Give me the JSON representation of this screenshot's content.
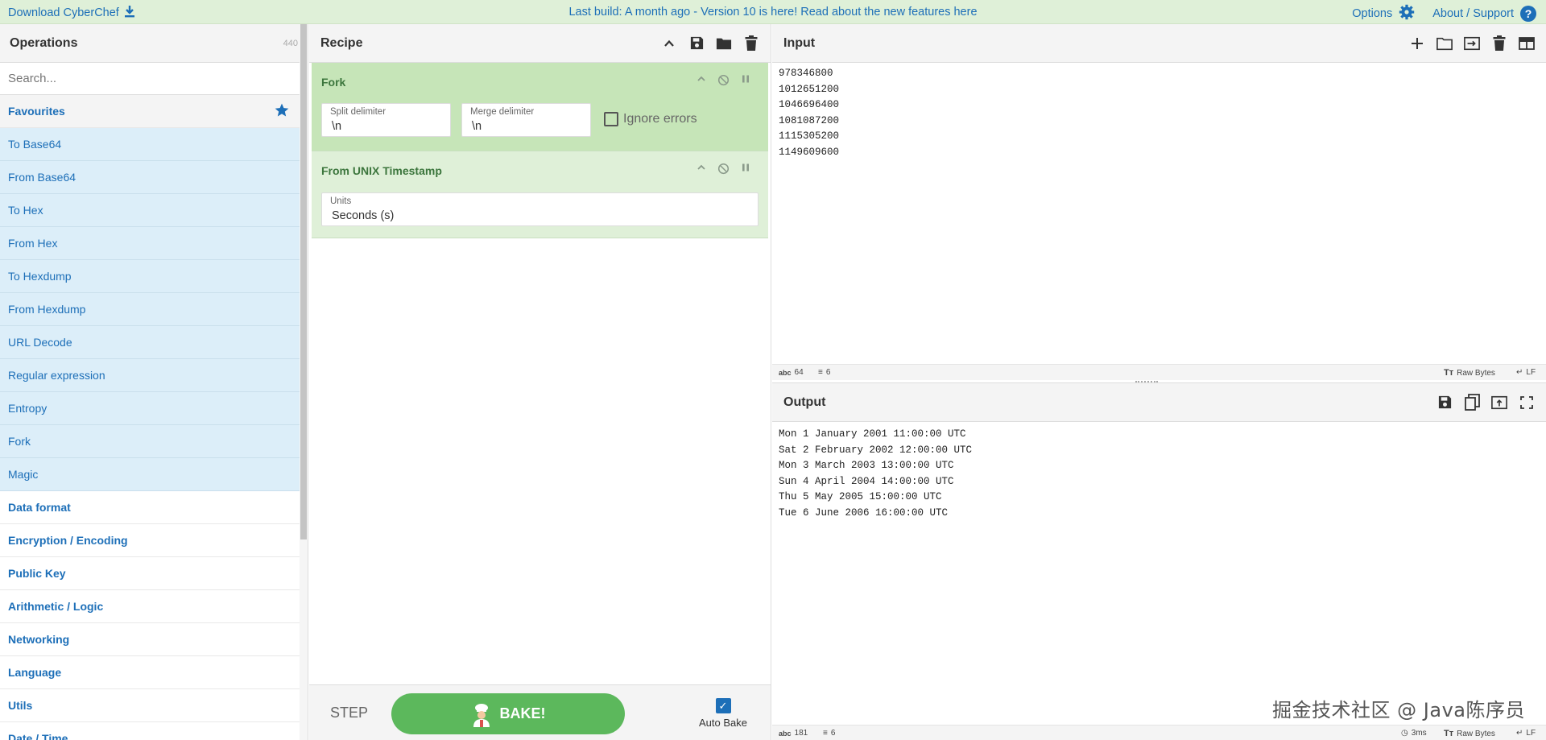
{
  "banner": {
    "download_label": "Download CyberChef",
    "build_message": "Last build: A month ago - Version 10 is here! Read about the new features here",
    "options_label": "Options",
    "about_label": "About / Support",
    "help_glyph": "?"
  },
  "operations": {
    "title": "Operations",
    "count": "440",
    "search_placeholder": "Search...",
    "favourites_label": "Favourites",
    "favourites": [
      "To Base64",
      "From Base64",
      "To Hex",
      "From Hex",
      "To Hexdump",
      "From Hexdump",
      "URL Decode",
      "Regular expression",
      "Entropy",
      "Fork",
      "Magic"
    ],
    "categories": [
      "Data format",
      "Encryption / Encoding",
      "Public Key",
      "Arithmetic / Logic",
      "Networking",
      "Language",
      "Utils",
      "Date / Time"
    ]
  },
  "recipe": {
    "title": "Recipe",
    "ops": [
      {
        "name": "Fork",
        "split_label": "Split delimiter",
        "split_value": "\\n",
        "merge_label": "Merge delimiter",
        "merge_value": "\\n",
        "ignore_errors_label": "Ignore errors"
      },
      {
        "name": "From UNIX Timestamp",
        "units_label": "Units",
        "units_value": "Seconds (s)"
      }
    ],
    "step_label": "STEP",
    "bake_label": "BAKE!",
    "autobake_label": "Auto Bake"
  },
  "input": {
    "title": "Input",
    "text": "978346800\n1012651200\n1046696400\n1081087200\n1115305200\n1149609600",
    "status": {
      "chars": "64",
      "lines": "6",
      "encoding": "Raw Bytes",
      "eol": "LF"
    }
  },
  "output": {
    "title": "Output",
    "text": "Mon 1 January 2001 11:00:00 UTC\nSat 2 February 2002 12:00:00 UTC\nMon 3 March 2003 13:00:00 UTC\nSun 4 April 2004 14:00:00 UTC\nThu 5 May 2005 15:00:00 UTC\nTue 6 June 2006 16:00:00 UTC",
    "status": {
      "chars": "181",
      "lines": "6",
      "time": "3ms",
      "encoding": "Raw Bytes",
      "eol": "LF"
    }
  },
  "watermark": "掘金技术社区 @ Java陈序员",
  "colors": {
    "accent": "#1d6fb8",
    "banner_bg": "#dff0d8",
    "fork_bg": "#c6e5b8",
    "op_bg": "#dff0d8",
    "fav_bg": "#dceef9",
    "bake_green": "#5cb85c"
  }
}
